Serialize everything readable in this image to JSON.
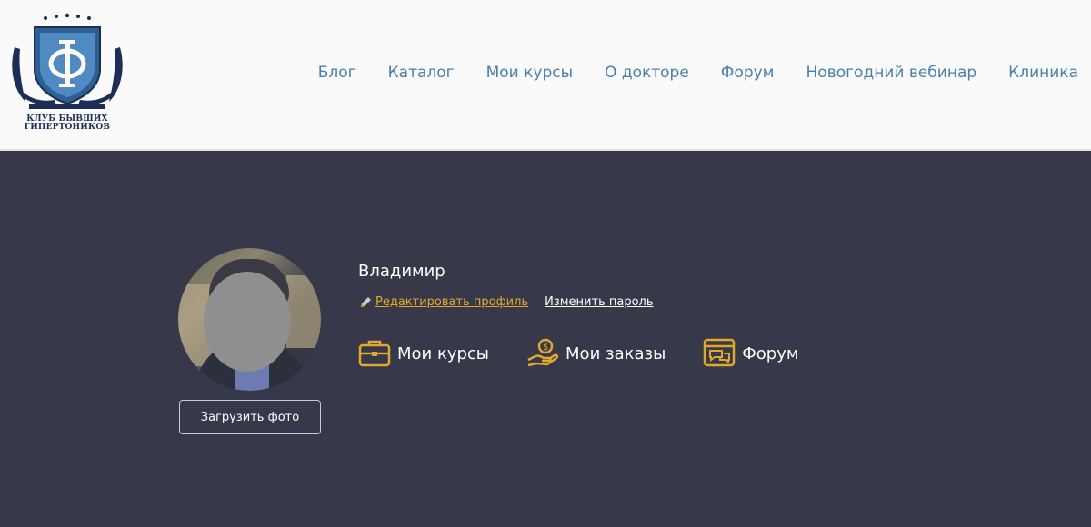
{
  "logo": {
    "line1": "КЛУБ БЫВШИХ",
    "line2": "ГИПЕРТОНИКОВ"
  },
  "nav": [
    {
      "label": "Блог"
    },
    {
      "label": "Каталог"
    },
    {
      "label": "Мои курсы"
    },
    {
      "label": "О докторе"
    },
    {
      "label": "Форум"
    },
    {
      "label": "Новогодний вебинар"
    },
    {
      "label": "Клиника"
    }
  ],
  "profile": {
    "name": "Владимир",
    "edit_profile": "Редактировать профиль",
    "change_password": "Изменить пароль",
    "upload_photo": "Загрузить фото"
  },
  "menu": [
    {
      "label": "Мои курсы",
      "icon": "briefcase-icon"
    },
    {
      "label": "Мои заказы",
      "icon": "money-hand-icon"
    },
    {
      "label": "Форум",
      "icon": "forum-icon"
    }
  ],
  "colors": {
    "nav_link": "#4a7fab",
    "page_bg": "#373849",
    "accent_gold": "#e0a92b",
    "logo_navy": "#1d2d55"
  }
}
